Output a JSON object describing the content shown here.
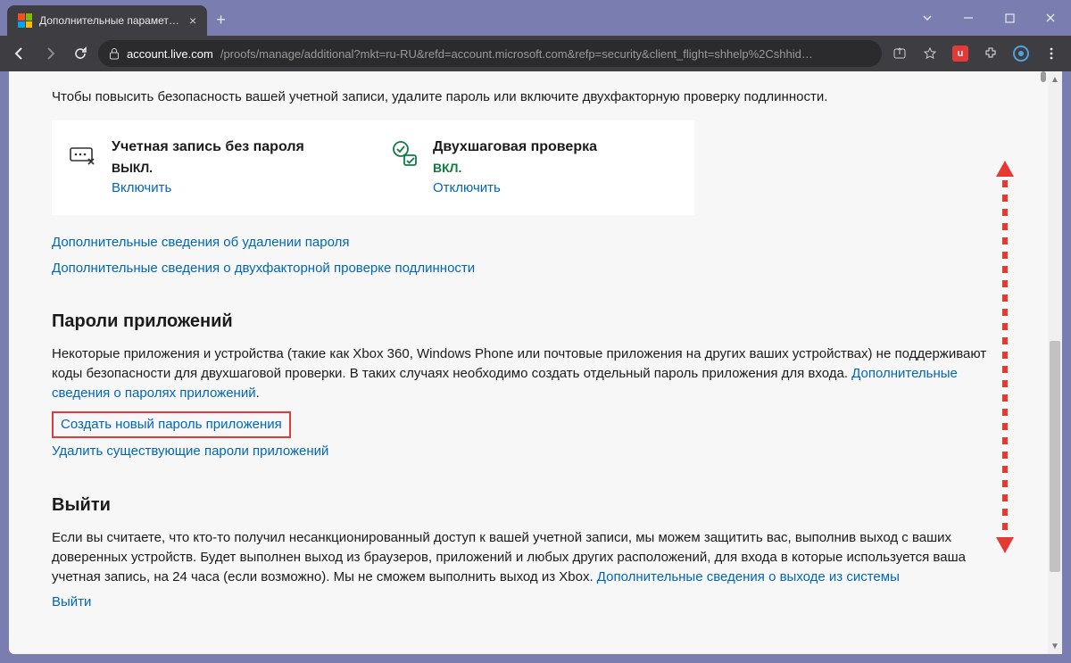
{
  "browser": {
    "tab_title": "Дополнительные параметры бе",
    "url_domain": "account.live.com",
    "url_path": "/proofs/manage/additional?mkt=ru-RU&refd=account.microsoft.com&refp=security&client_flight=shhelp%2Cshhid…"
  },
  "intro": "Чтобы повысить безопасность вашей учетной записи, удалите пароль или включите двухфакторную проверку подлинности.",
  "cards": {
    "passwordless": {
      "title": "Учетная запись без пароля",
      "status": "ВЫКЛ.",
      "action": "Включить"
    },
    "twostep": {
      "title": "Двухшаговая проверка",
      "status": "ВКЛ.",
      "action": "Отключить"
    }
  },
  "links": {
    "more_remove_pw": "Дополнительные сведения об удалении пароля",
    "more_2fa": "Дополнительные сведения о двухфакторной проверке подлинности"
  },
  "app_passwords": {
    "heading": "Пароли приложений",
    "text": "Некоторые приложения и устройства (такие как Xbox 360, Windows Phone или почтовые приложения на других ваших устройствах) не поддерживают коды безопасности для двухшаговой проверки. В таких случаях необходимо создать отдельный пароль приложения для входа. ",
    "text_link": "Дополнительные сведения о паролях приложений",
    "create": "Создать новый пароль приложения",
    "delete": "Удалить существующие пароли приложений"
  },
  "signout": {
    "heading": "Выйти",
    "text": "Если вы считаете, что кто-то получил несанкционированный доступ к вашей учетной записи, мы можем защитить вас, выполнив выход с ваших доверенных устройств. Будет выполнен выход из браузеров, приложений и любых других расположений, для входа в которые используется ваша учетная запись, на 24 часа (если возможно). Мы не сможем выполнить выход из Xbox. ",
    "text_link": "Дополнительные сведения о выходе из системы",
    "action": "Выйти"
  }
}
